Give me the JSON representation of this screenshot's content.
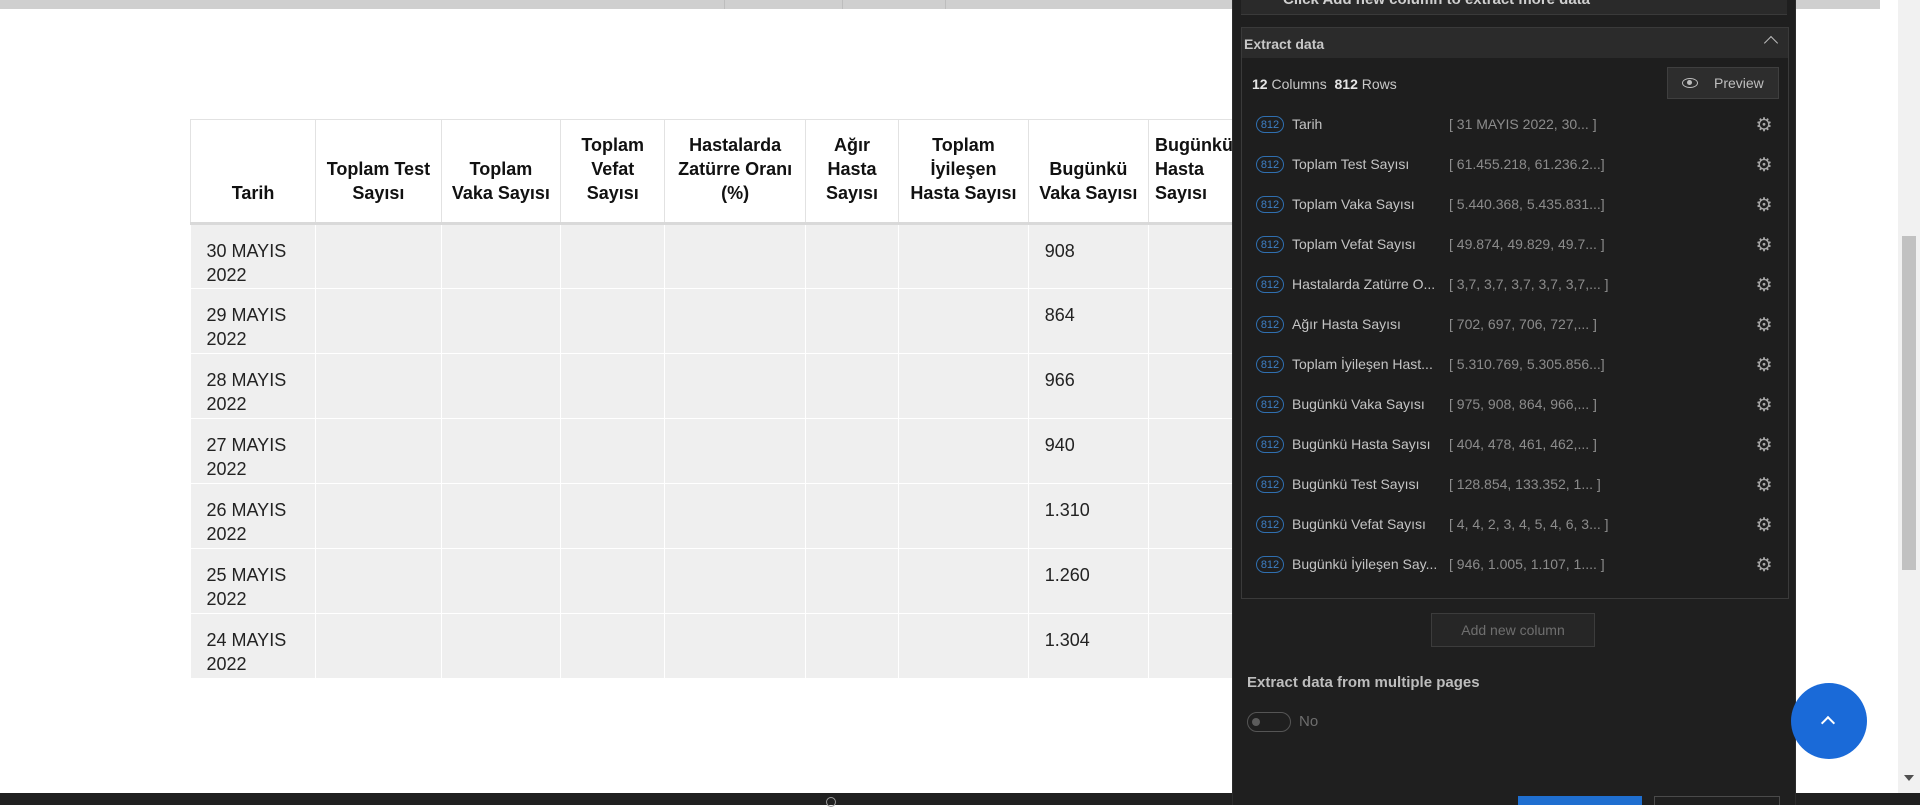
{
  "table": {
    "headers": [
      "Tarih",
      "Toplam Test Sayısı",
      "Toplam Vaka Sayısı",
      "Toplam Vefat Sayısı",
      "Hastalarda Zatürre Oranı (%)",
      "Ağır Hasta Sayısı",
      "Toplam İyileşen Hasta Sayısı",
      "Bugünkü Vaka Sayısı",
      "Bugünkü Hasta Sayısı"
    ],
    "rows": [
      {
        "date": "30 MAYIS\n2022",
        "today_cases": "908"
      },
      {
        "date": "29 MAYIS\n2022",
        "today_cases": "864"
      },
      {
        "date": "28 MAYIS\n2022",
        "today_cases": "966"
      },
      {
        "date": "27 MAYIS\n2022",
        "today_cases": "940"
      },
      {
        "date": "26 MAYIS\n2022",
        "today_cases": "1.310"
      },
      {
        "date": "25 MAYIS\n2022",
        "today_cases": "1.260"
      },
      {
        "date": "24 MAYIS\n2022",
        "today_cases": "1.304"
      }
    ]
  },
  "panel": {
    "previous_hint": "Click Add new column to extract more data",
    "section_title": "Extract data",
    "columns_count": "12",
    "columns_label": "Columns",
    "rows_count": "812",
    "rows_label": "Rows",
    "preview_label": "Preview",
    "columns": [
      {
        "badge": "812",
        "name": "Tarih",
        "values": "[ 31 MAYIS 2022, 30...   ]"
      },
      {
        "badge": "812",
        "name": "Toplam Test Sayısı",
        "values": "[ 61.455.218, 61.236.2...]"
      },
      {
        "badge": "812",
        "name": "Toplam Vaka Sayısı",
        "values": "[ 5.440.368, 5.435.831...]"
      },
      {
        "badge": "812",
        "name": "Toplam Vefat Sayısı",
        "values": "[ 49.874, 49.829, 49.7...  ]"
      },
      {
        "badge": "812",
        "name": "Hastalarda Zatürre O...",
        "values": "[ 3,7, 3,7, 3,7, 3,7, 3,7,...  ]"
      },
      {
        "badge": "812",
        "name": "Ağır Hasta Sayısı",
        "values": "[ 702, 697, 706, 727,...   ]"
      },
      {
        "badge": "812",
        "name": "Toplam İyileşen Hast...",
        "values": "[ 5.310.769, 5.305.856...]"
      },
      {
        "badge": "812",
        "name": "Bugünkü Vaka Sayısı",
        "values": "[ 975, 908, 864, 966,...   ]"
      },
      {
        "badge": "812",
        "name": "Bugünkü Hasta Sayısı",
        "values": "[ 404, 478, 461, 462,...   ]"
      },
      {
        "badge": "812",
        "name": "Bugünkü Test Sayısı",
        "values": "[ 128.854, 133.352, 1...   ]"
      },
      {
        "badge": "812",
        "name": "Bugünkü Vefat Sayısı",
        "values": "[ 4, 4, 2, 3, 4, 5, 4, 6, 3...  ]"
      },
      {
        "badge": "812",
        "name": "Bugünkü İyileşen Say...",
        "values": "[ 946, 1.005, 1.107, 1....   ]"
      }
    ],
    "add_column_label": "Add new column",
    "multi_pages_title": "Extract data from multiple pages",
    "multi_pages_value": "No",
    "icons": {
      "gear": "gear-icon",
      "eye": "eye-icon",
      "chevron": "chevron-up-icon"
    }
  },
  "colors": {
    "panel_bg": "#1f1f1f",
    "accent": "#1a6ad8",
    "badge": "#2f6fb0"
  }
}
